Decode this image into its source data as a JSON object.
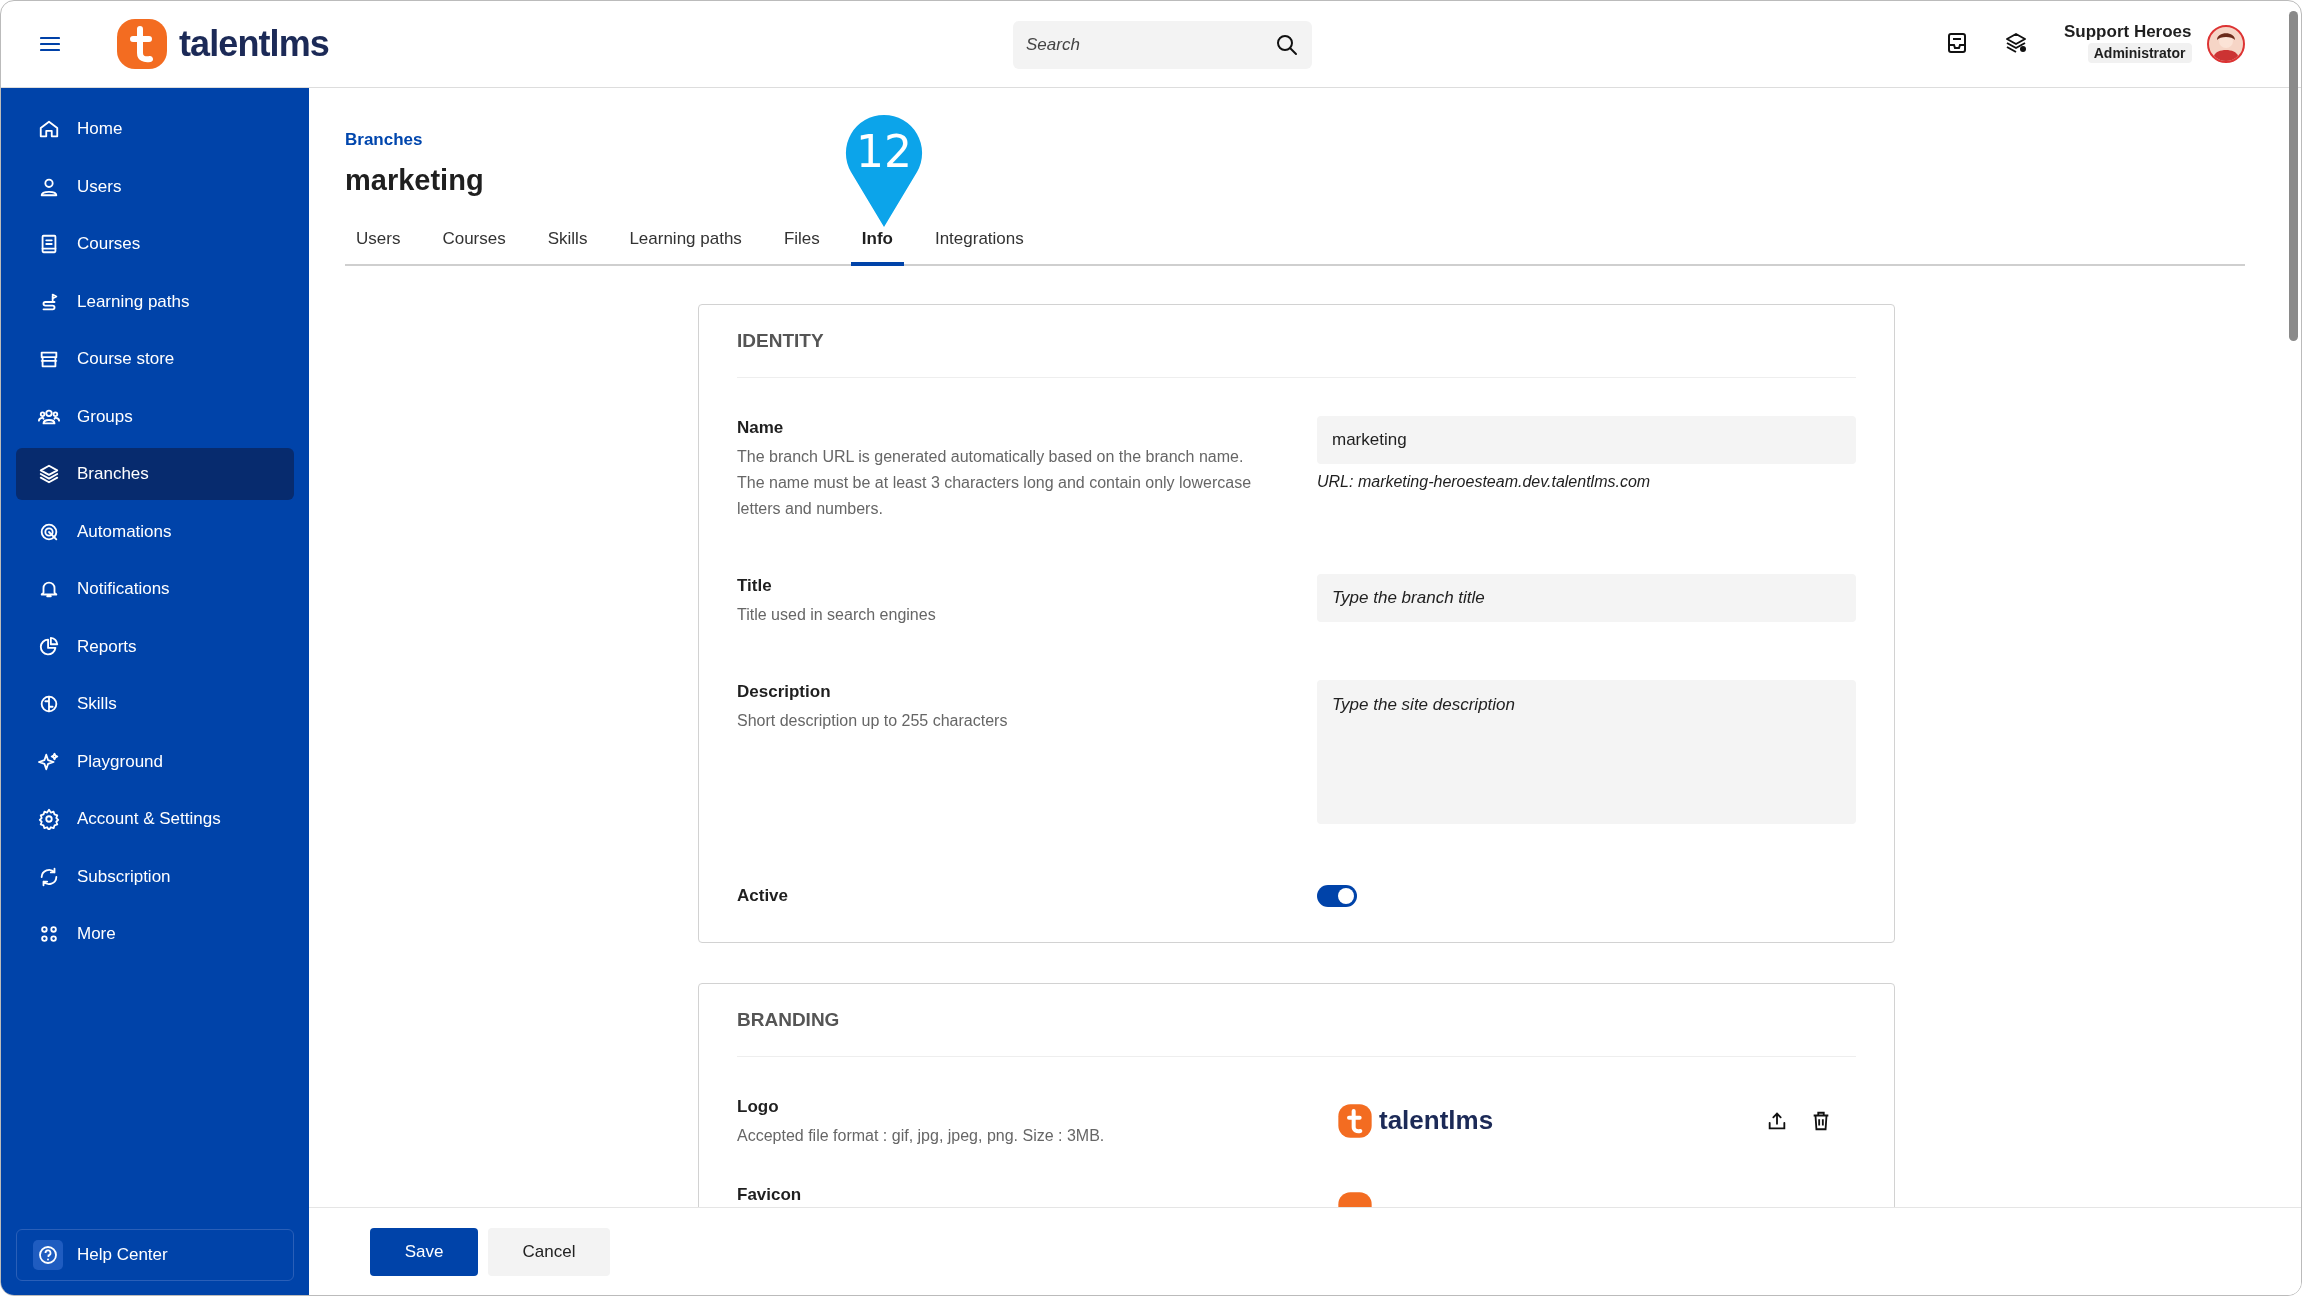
{
  "header": {
    "logo_text": "talentlms",
    "search": {
      "placeholder": "Search"
    },
    "user": {
      "name": "Support Heroes",
      "role": "Administrator"
    }
  },
  "sidebar": {
    "items": [
      {
        "label": "Home",
        "selected": false
      },
      {
        "label": "Users",
        "selected": false
      },
      {
        "label": "Courses",
        "selected": false
      },
      {
        "label": "Learning paths",
        "selected": false
      },
      {
        "label": "Course store",
        "selected": false
      },
      {
        "label": "Groups",
        "selected": false
      },
      {
        "label": "Branches",
        "selected": true
      },
      {
        "label": "Automations",
        "selected": false
      },
      {
        "label": "Notifications",
        "selected": false
      },
      {
        "label": "Reports",
        "selected": false
      },
      {
        "label": "Skills",
        "selected": false
      },
      {
        "label": "Playground",
        "selected": false
      },
      {
        "label": "Account & Settings",
        "selected": false
      },
      {
        "label": "Subscription",
        "selected": false
      },
      {
        "label": "More",
        "selected": false
      }
    ],
    "help": "Help Center"
  },
  "breadcrumb": "Branches",
  "title": "marketing",
  "tabs": [
    {
      "label": "Users",
      "selected": false
    },
    {
      "label": "Courses",
      "selected": false
    },
    {
      "label": "Skills",
      "selected": false
    },
    {
      "label": "Learning paths",
      "selected": false
    },
    {
      "label": "Files",
      "selected": false
    },
    {
      "label": "Info",
      "selected": true
    },
    {
      "label": "Integrations",
      "selected": false
    }
  ],
  "marker": "12",
  "identity": {
    "heading": "IDENTITY",
    "rows": [
      {
        "kind": "input",
        "label": "Name",
        "help": "The branch URL is generated automatically based on the branch name. The name must be at least 3 characters long and contain only lowercase letters and numbers.",
        "value": "marketing",
        "note": "URL: marketing-heroesteam.dev.talentlms.com"
      },
      {
        "kind": "input",
        "label": "Title",
        "help": "Title used in search engines",
        "placeholder": "Type the branch title"
      },
      {
        "kind": "textarea",
        "label": "Description",
        "help": "Short description up to 255 characters",
        "placeholder": "Type the site description"
      },
      {
        "kind": "toggle",
        "label": "Active",
        "on": true
      }
    ]
  },
  "branding": {
    "heading": "BRANDING",
    "rows": [
      {
        "kind": "logo",
        "label": "Logo",
        "help": "Accepted file format : gif, jpg, jpeg, png. Size : 3MB.",
        "logo_text": "talentlms"
      },
      {
        "kind": "favicon",
        "label": "Favicon"
      }
    ]
  },
  "footer": {
    "buttons": [
      {
        "label": "Save",
        "kind": "primary"
      },
      {
        "label": "Cancel",
        "kind": "secondary"
      }
    ]
  }
}
